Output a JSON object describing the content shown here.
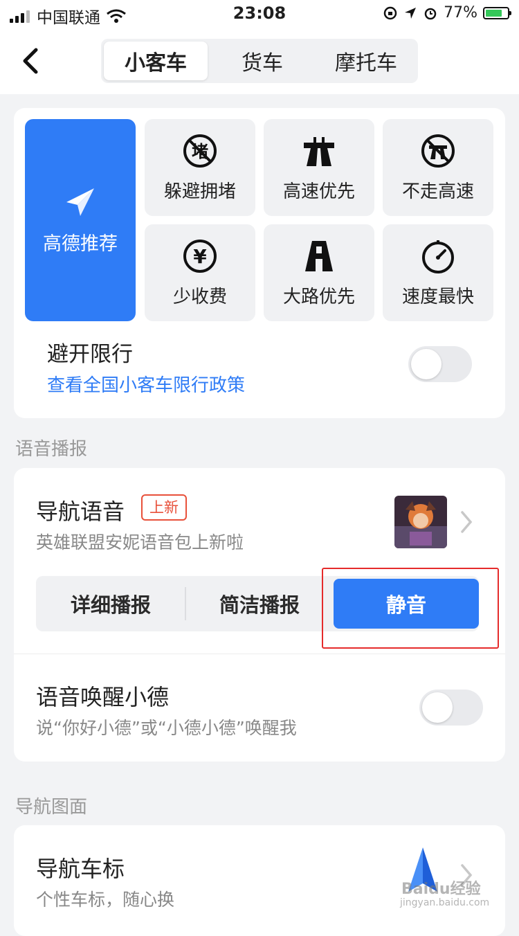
{
  "status_bar": {
    "carrier": "中国联通",
    "time": "23:08",
    "battery": "77%",
    "battery_level": 0.77
  },
  "tabs": [
    {
      "label": "小客车",
      "active": true
    },
    {
      "label": "货车",
      "active": false
    },
    {
      "label": "摩托车",
      "active": false
    }
  ],
  "route_prefs": {
    "recommended": {
      "label": "高德推荐",
      "icon": "paper-plane-icon"
    },
    "options": [
      {
        "label": "躲避拥堵",
        "icon": "congestion-icon",
        "icon_text": "堵"
      },
      {
        "label": "高速优先",
        "icon": "highway-icon"
      },
      {
        "label": "不走高速",
        "icon": "no-highway-icon"
      },
      {
        "label": "少收费",
        "icon": "yuan-icon",
        "icon_text": "¥"
      },
      {
        "label": "大路优先",
        "icon": "main-road-icon"
      },
      {
        "label": "速度最快",
        "icon": "speedometer-icon"
      }
    ],
    "avoid_restriction": {
      "title": "避开限行",
      "link": "查看全国小客车限行政策",
      "enabled": false
    }
  },
  "voice_section": {
    "header": "语音播报",
    "nav_voice": {
      "title": "导航语音",
      "badge": "上新",
      "subtitle": "英雄联盟安妮语音包上新啦"
    },
    "modes": [
      {
        "label": "详细播报",
        "active": false
      },
      {
        "label": "简洁播报",
        "active": false
      },
      {
        "label": "静音",
        "active": true
      }
    ],
    "wake": {
      "title": "语音唤醒小德",
      "subtitle": "说“你好小德”或“小德小德”唤醒我",
      "enabled": false
    }
  },
  "display_section": {
    "header": "导航图面",
    "car_icon": {
      "title": "导航车标",
      "subtitle": "个性车标，随心换"
    }
  },
  "watermark": {
    "brand": "Baidu经验",
    "url": "jingyan.baidu.com"
  },
  "colors": {
    "accent": "#2f7cf6",
    "badge": "#e8503a",
    "highlight": "#e52b2b"
  }
}
